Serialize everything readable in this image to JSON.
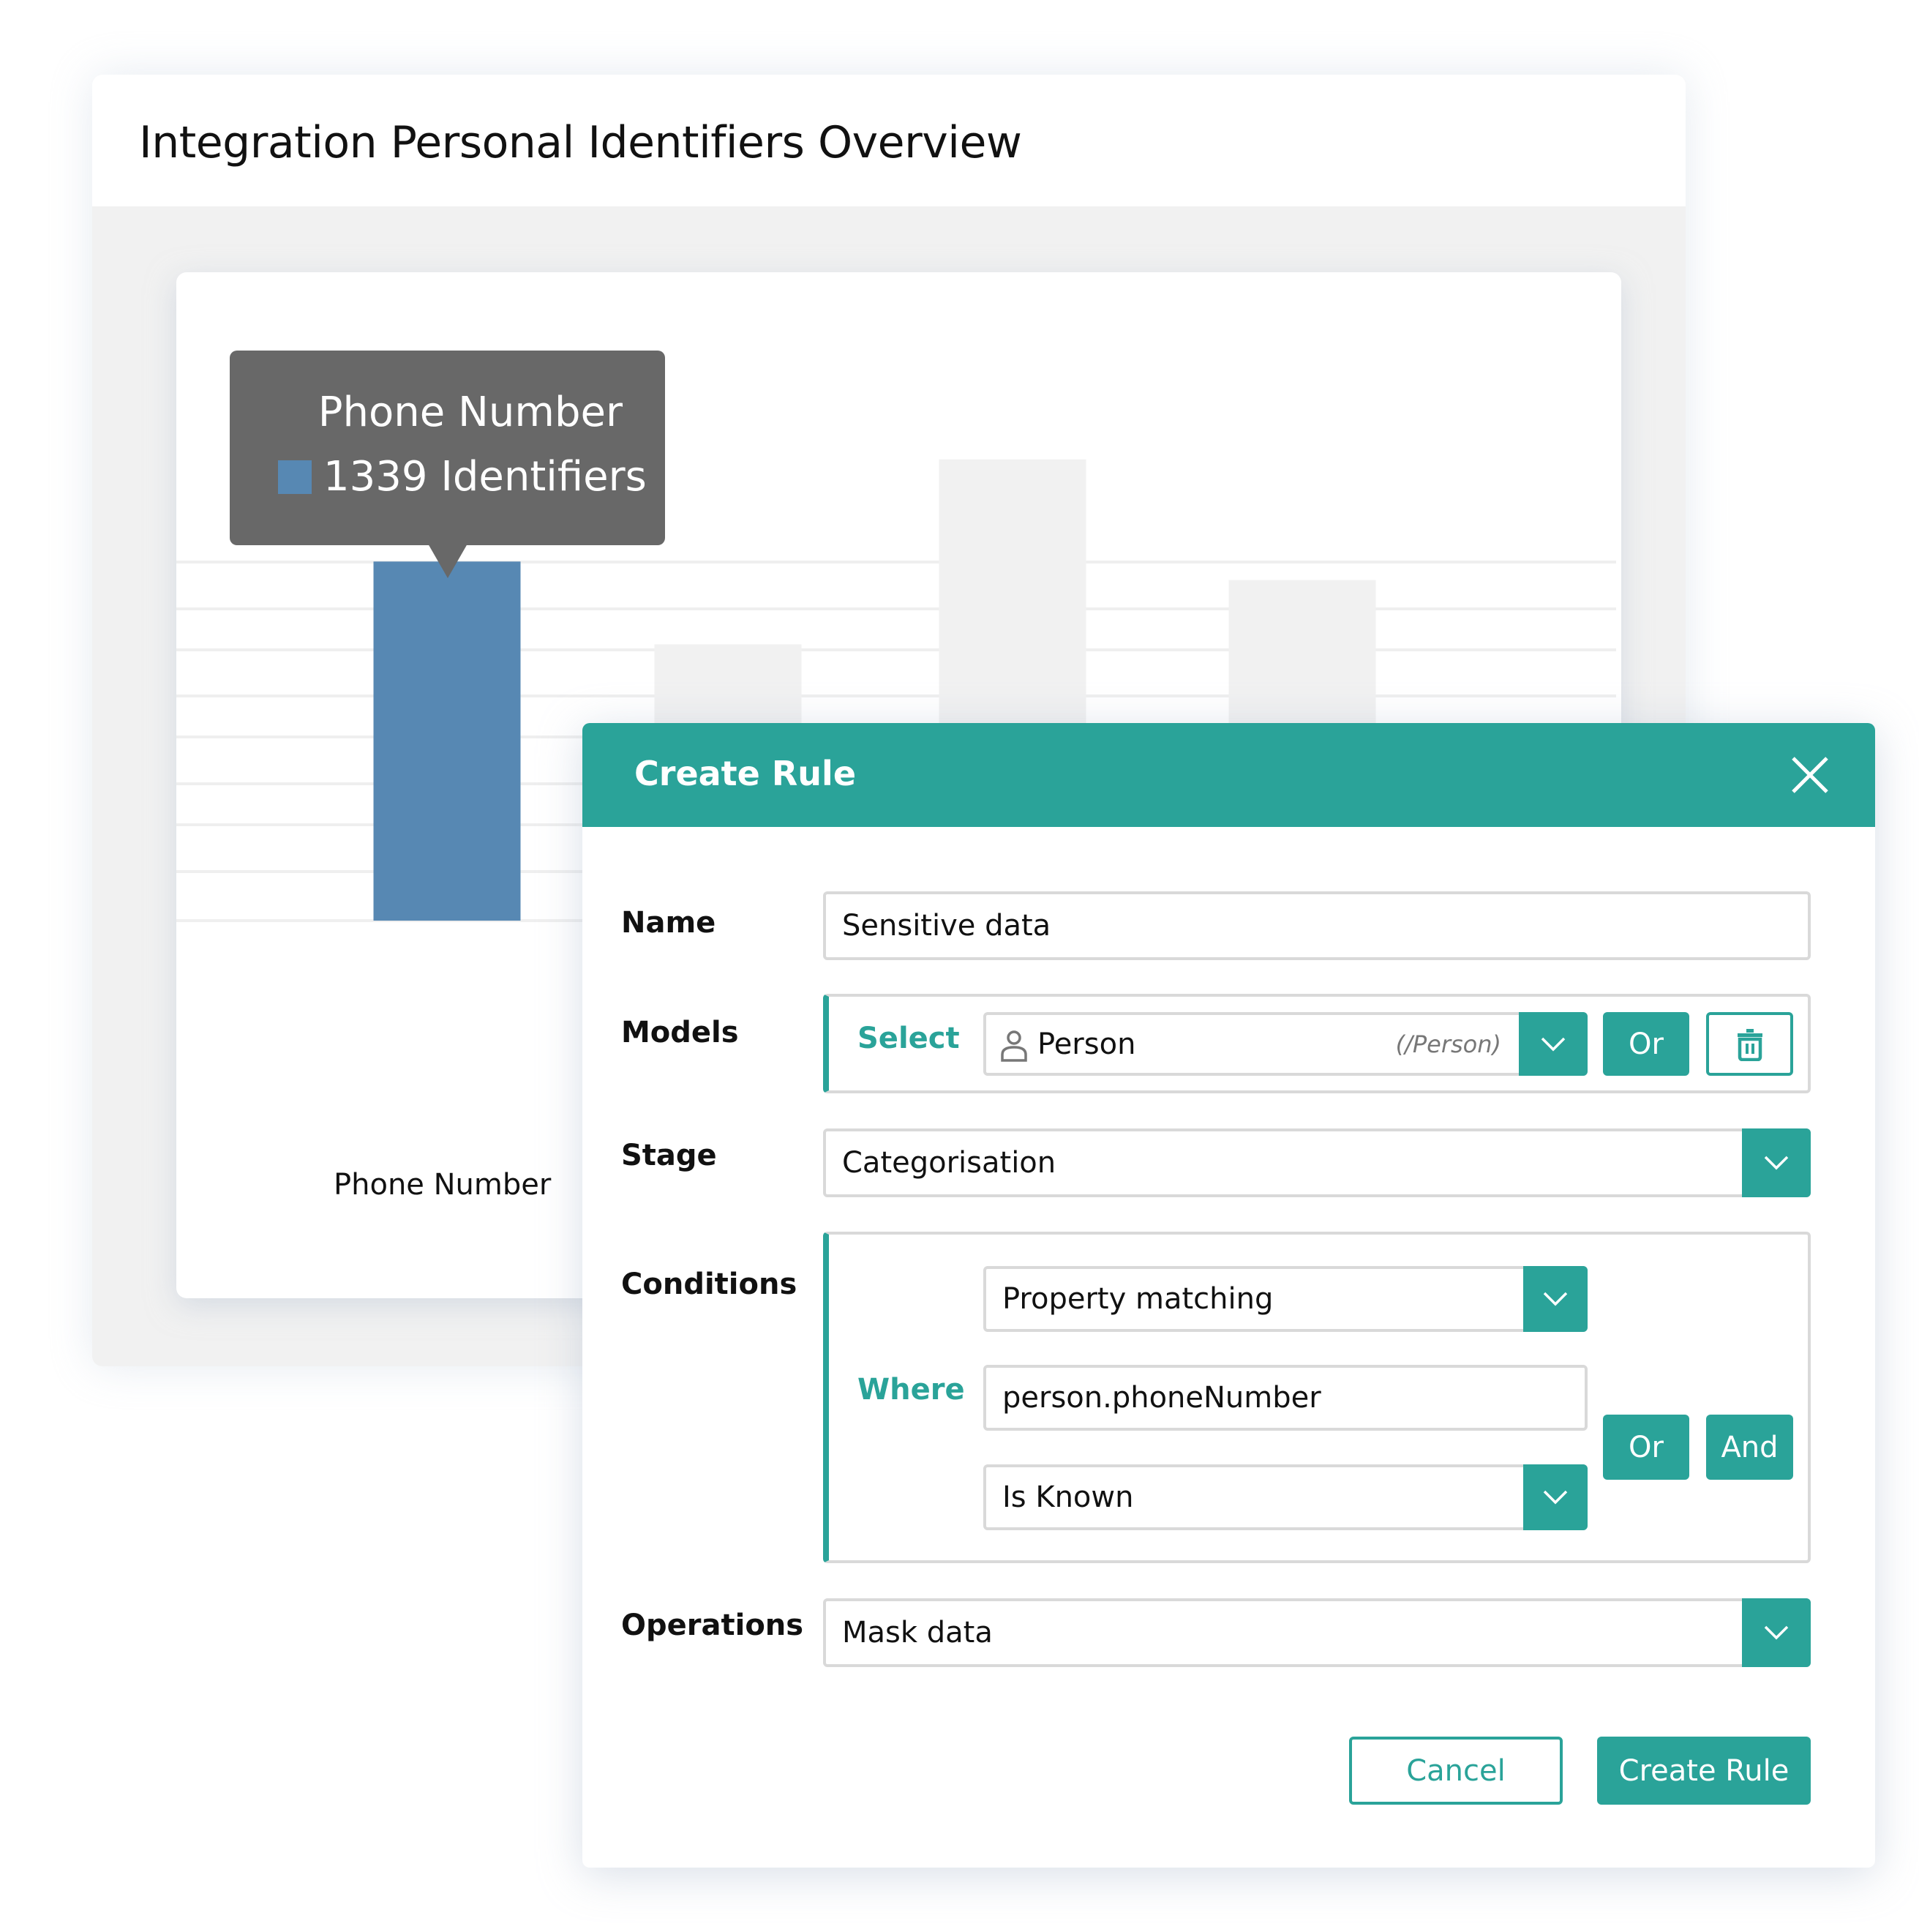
{
  "overview": {
    "title": "Integration Personal Identifiers Overview"
  },
  "chart_data": {
    "type": "bar",
    "title": "",
    "xlabel": "",
    "ylabel": "Identifiers",
    "categories": [
      "Phone Number",
      "",
      "",
      ""
    ],
    "values": [
      1339,
      1030,
      1720,
      1270
    ],
    "highlighted_index": 0,
    "visible_tick_labels": [
      "Phone Number"
    ],
    "ylim": [
      0,
      1550
    ],
    "grid": true,
    "colors": {
      "highlight": "#5788b3",
      "muted": "#f1f1f1",
      "grid": "#efefef"
    },
    "tooltip": {
      "title": "Phone Number",
      "value_text": "1339 Identifiers",
      "swatch_color": "#5788b3"
    }
  },
  "modal": {
    "title": "Create Rule",
    "close_icon": "close-icon",
    "accent_color": "#2aa399",
    "fields": {
      "name": {
        "label": "Name",
        "value": "Sensitive data"
      },
      "models": {
        "label": "Models",
        "select_label": "Select",
        "model_icon": "person-icon",
        "model_value": "Person",
        "model_path": "(/Person)",
        "or_label": "Or",
        "delete_icon": "trash-icon"
      },
      "stage": {
        "label": "Stage",
        "value": "Categorisation"
      },
      "conditions": {
        "label": "Conditions",
        "where_label": "Where",
        "matcher": "Property matching",
        "property": "person.phoneNumber",
        "operator": "Is Known",
        "or_label": "Or",
        "and_label": "And"
      },
      "operations": {
        "label": "Operations",
        "value": "Mask data"
      }
    },
    "footer": {
      "cancel_label": "Cancel",
      "submit_label": "Create Rule"
    }
  }
}
